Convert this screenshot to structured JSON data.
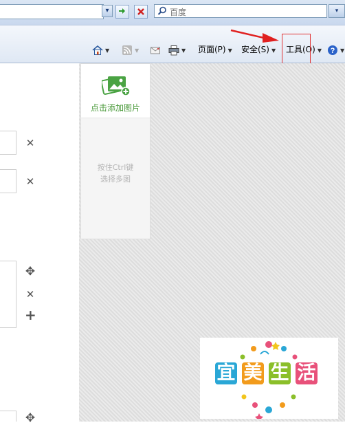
{
  "address_bar": {
    "dropdown_glyph": "▾",
    "refresh_icon": "go-refresh-icon",
    "stop_icon": "stop-icon",
    "search_placeholder": "百度",
    "search_icon": "search-icon"
  },
  "command_bar": {
    "home_icon": "home-icon",
    "feeds_icon": "rss-feed-icon",
    "mail_icon": "mail-icon",
    "print_icon": "print-icon",
    "page_label": "页面(P)",
    "safety_label": "安全(S)",
    "tools_label": "工具(O)",
    "help_icon": "help-icon",
    "dropdown_arrow": "▼"
  },
  "annotation": {
    "arrow_color": "#e02020",
    "highlight_color": "#e03030"
  },
  "editor": {
    "remove_glyph": "✕",
    "move_glyph": "✥",
    "add_glyph": "+"
  },
  "upload": {
    "add_label": "点击添加图片",
    "hint_line1": "按住Ctrl键",
    "hint_line2": "选择多图"
  },
  "logo": {
    "chars": [
      "宜",
      "美",
      "生",
      "活"
    ],
    "colors": [
      "#2aa7d6",
      "#f29b1c",
      "#8bbf2a",
      "#e8517a"
    ]
  }
}
